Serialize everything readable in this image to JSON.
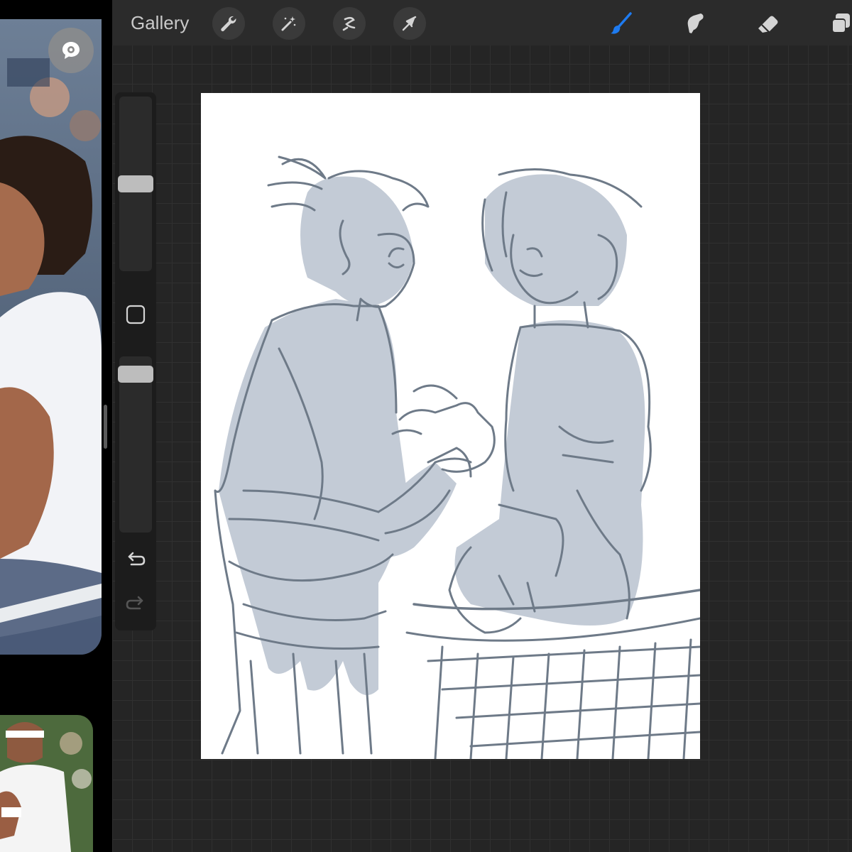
{
  "topbar": {
    "gallery_label": "Gallery",
    "tools_left": [
      "wrench-icon",
      "magic-wand-icon",
      "selection-icon",
      "transform-arrow-icon"
    ],
    "tools_right": [
      "brush-icon",
      "smudge-icon",
      "eraser-icon",
      "layers-icon"
    ],
    "active_tool": "brush-icon",
    "active_color": "#1e7bf0"
  },
  "sidebar": {
    "brush_size": 0.5,
    "opacity": 0.94,
    "icons": [
      "modify-square-icon",
      "undo-icon",
      "redo-icon"
    ]
  },
  "reference": {
    "icons": [
      "comment-icon"
    ]
  },
  "colors": {
    "sketch_line": "#6e7a88",
    "sketch_fill": "#b9c2cf",
    "app_bg": "#252525",
    "toolbar_bg": "#2b2b2b"
  }
}
